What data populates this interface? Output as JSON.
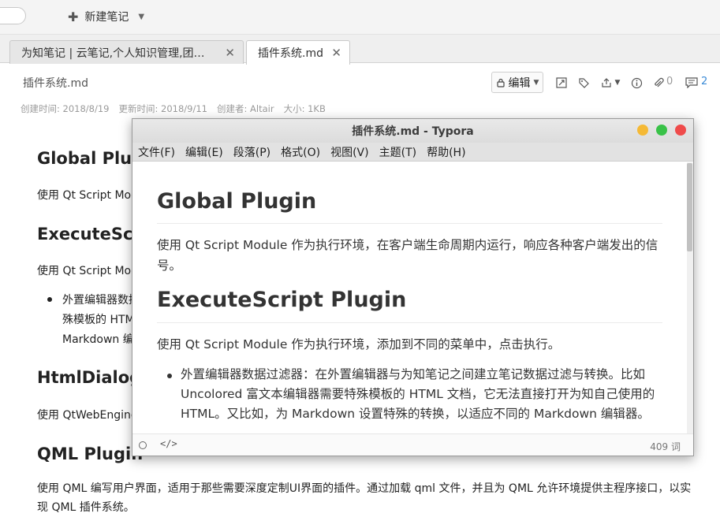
{
  "toolbar": {
    "new_note": "新建笔记"
  },
  "tabs": [
    {
      "label": "为知笔记 | 云笔记,个人知识管理,团…"
    },
    {
      "label": "插件系统.md"
    }
  ],
  "note": {
    "title": "插件系统.md",
    "created": "创建时间: 2018/8/19",
    "updated": "更新时间: 2018/9/11",
    "author": "创建者: Altair",
    "size": "大小: 1KB",
    "edit_label": "编辑",
    "attachments_count": "0",
    "comments_count": "2"
  },
  "background_doc": {
    "h_global": "Global Plugin",
    "p_global": "使用 Qt Script Module 作为执行环境，在客户端生命周期内运行，响应各种客户端发出的信号。",
    "h_execute": "ExecuteScript Plugin",
    "p_execute": "使用 Qt Script Module 作为执行环境，添加到不同的菜单中，点击执行。",
    "li_line1": "外置编辑器数据过滤器：在外置编辑器与为知笔记之间建立笔记数据过滤与转换。比如",
    "li_line2": "殊模板的 HTML 文档，它无法直接打开为知自己使用的 HTML。又比如，为",
    "li_line3": "Markdown 编辑器。",
    "h_html": "HtmlDialog Plugin",
    "p_html": "使用 QtWebEngine 作为执行环境",
    "h_qml": "QML Plugin",
    "p_qml": "使用 QML 编写用户界面，适用于那些需要深度定制UI界面的插件。通过加载 qml 文件，并且为 QML 允许环境提供主程序接口，以实现 QML 插件系统。"
  },
  "typora": {
    "window_title": "插件系统.md - Typora",
    "menu": [
      "文件(F)",
      "编辑(E)",
      "段落(P)",
      "格式(O)",
      "视图(V)",
      "主题(T)",
      "帮助(H)"
    ],
    "h1_global": "Global Plugin",
    "p_global": "使用 Qt Script Module 作为执行环境，在客户端生命周期内运行，响应各种客户端发出的信号。",
    "h1_execute": "ExecuteScript Plugin",
    "p_execute": "使用 Qt Script Module 作为执行环境，添加到不同的菜单中，点击执行。",
    "li_text": "外置编辑器数据过滤器：在外置编辑器与为知笔记之间建立笔记数据过滤与转换。比如 Uncolored 富文本编辑器需要特殊模板的 HTML 文档，它无法直接打开为知自己使用的 HTML。又比如，为 Markdown 设置特殊的转换，以适应不同的 Markdown 编辑器。",
    "code_toggle": "</>",
    "word_count": "409 词"
  }
}
